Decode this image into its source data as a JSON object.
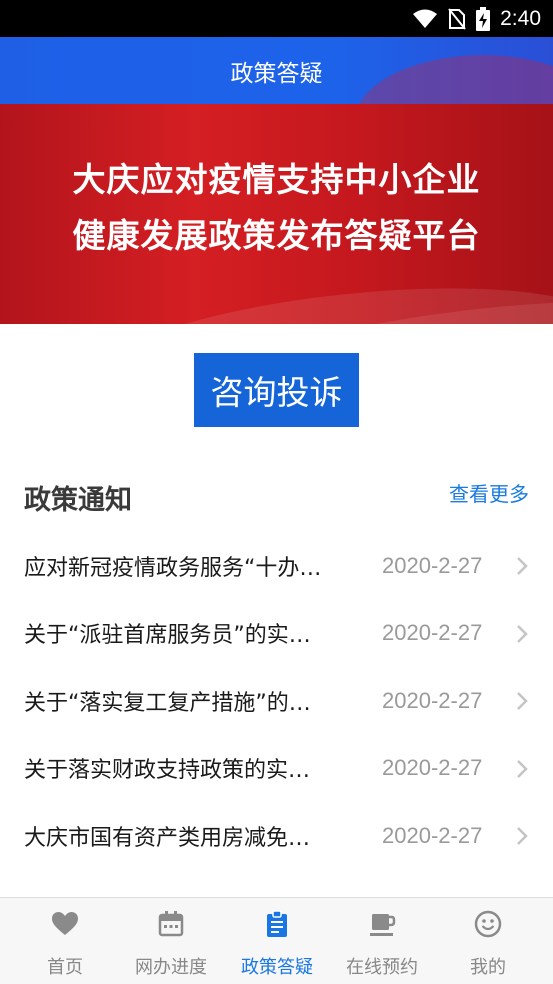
{
  "status_bar": {
    "time": "2:40"
  },
  "header": {
    "title": "政策答疑"
  },
  "banner": {
    "line1": "大庆应对疫情支持中小企业",
    "line2": "健康发展政策发布答疑平台"
  },
  "consult_button": {
    "label": "咨询投诉"
  },
  "policy_section": {
    "title": "政策通知",
    "more_label": "查看更多",
    "items": [
      {
        "title": "应对新冠疫情政务服务“十办…",
        "date": "2020-2-27"
      },
      {
        "title": "关于“派驻首席服务员”的实…",
        "date": "2020-2-27"
      },
      {
        "title": "关于“落实复工复产措施”的…",
        "date": "2020-2-27"
      },
      {
        "title": "关于落实财政支持政策的实…",
        "date": "2020-2-27"
      },
      {
        "title": "大庆市国有资产类用房减免…",
        "date": "2020-2-27"
      }
    ]
  },
  "tabbar": {
    "tabs": [
      {
        "label": "首页",
        "icon": "heart-icon"
      },
      {
        "label": "网办进度",
        "icon": "calendar-icon"
      },
      {
        "label": "政策答疑",
        "icon": "clipboard-icon",
        "active": true
      },
      {
        "label": "在线预约",
        "icon": "coffee-cup-icon"
      },
      {
        "label": "我的",
        "icon": "smiley-icon"
      }
    ]
  },
  "colors": {
    "header_blue": "#1d63ea",
    "banner_red": "#d41f23",
    "button_blue": "#1565d8",
    "link_blue": "#1a7be0",
    "active_tab": "#1976e3",
    "inactive_tab": "#888888"
  }
}
